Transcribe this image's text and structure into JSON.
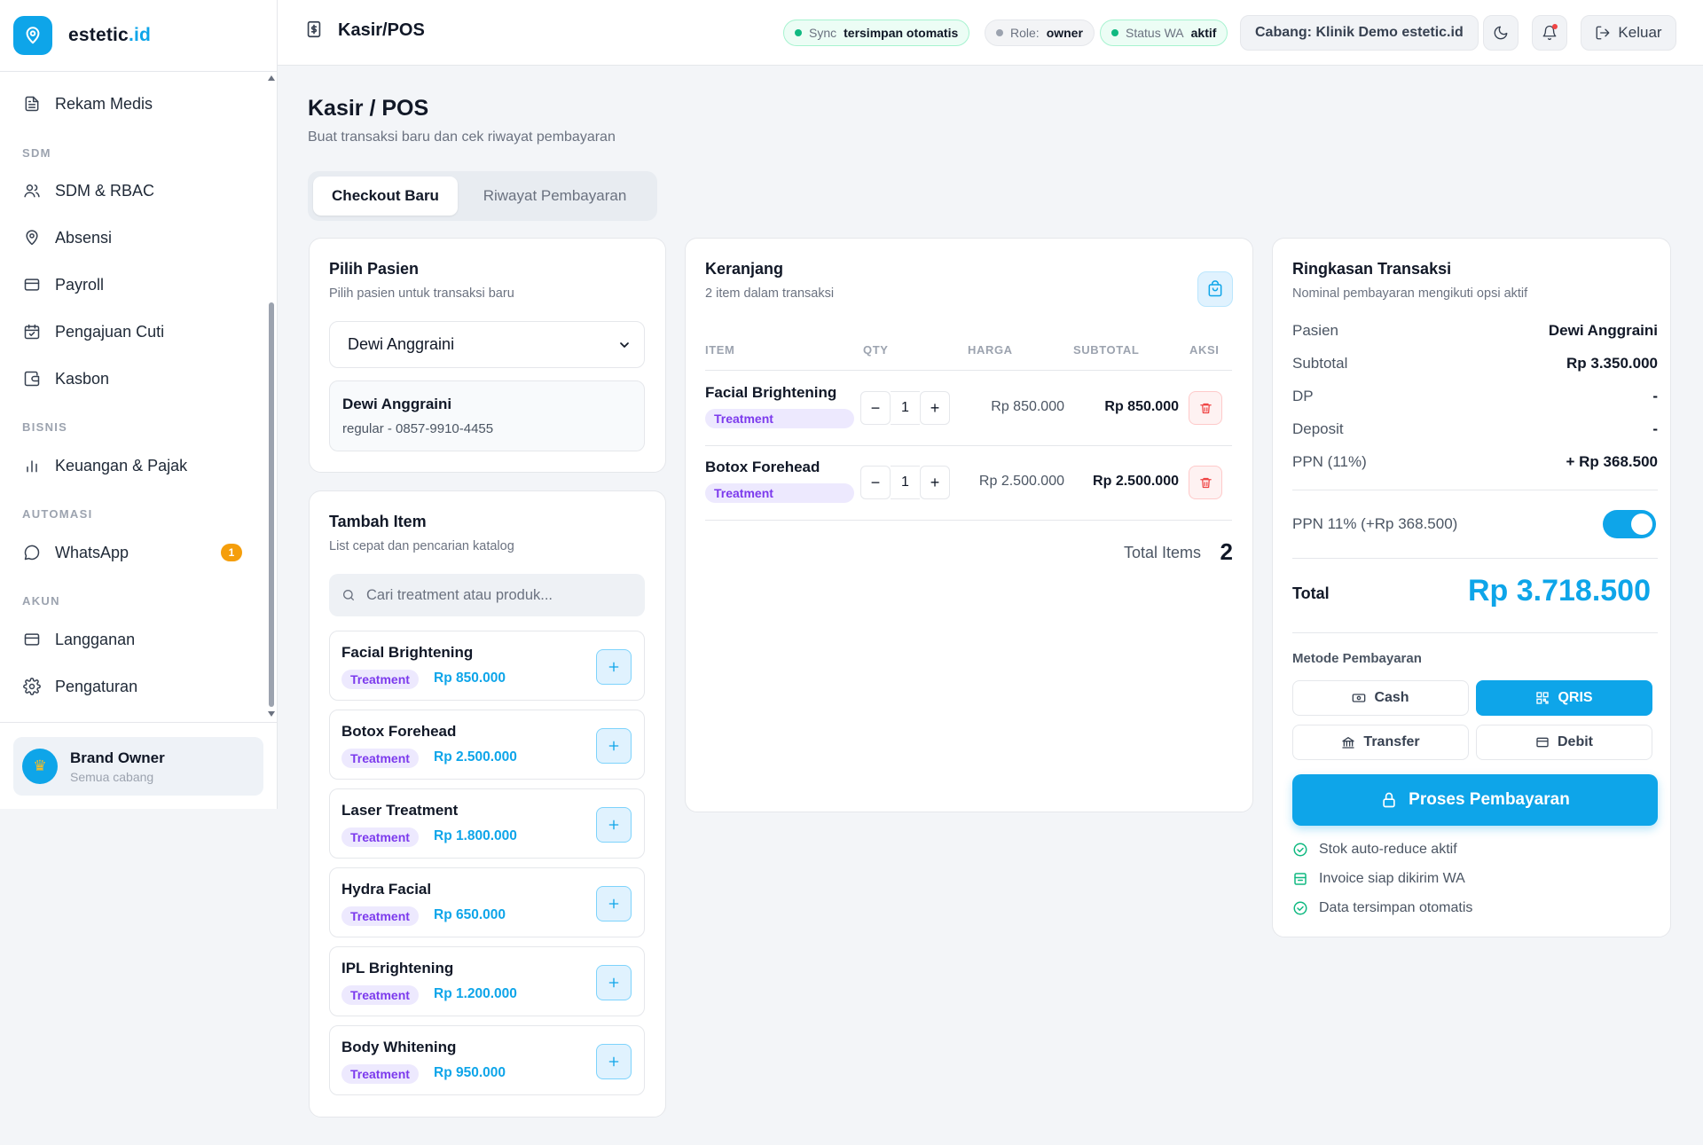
{
  "app": {
    "brand_name": "estetic",
    "brand_tld": ".id",
    "accent": "#0ea5e9"
  },
  "sidebar": {
    "items": [
      {
        "label": "Rekam Medis",
        "icon": "file-text-icon"
      },
      {
        "label": "SDM & RBAC",
        "icon": "users-icon"
      },
      {
        "label": "Absensi",
        "icon": "map-pin-icon"
      },
      {
        "label": "Payroll",
        "icon": "credit-card-icon"
      },
      {
        "label": "Pengajuan Cuti",
        "icon": "calendar-icon"
      },
      {
        "label": "Kasbon",
        "icon": "wallet-icon"
      },
      {
        "label": "Keuangan & Pajak",
        "icon": "bar-chart-icon"
      },
      {
        "label": "WhatsApp",
        "icon": "chat-bubble-icon",
        "badge": "1"
      },
      {
        "label": "Langganan",
        "icon": "credit-card-icon"
      },
      {
        "label": "Pengaturan",
        "icon": "gear-icon"
      }
    ],
    "sections": [
      "SDM",
      "BISNIS",
      "AUTOMASI",
      "AKUN"
    ],
    "user": {
      "name": "Brand Owner",
      "sub": "Semua cabang",
      "avatar": "crown-icon"
    }
  },
  "topbar": {
    "title": "Kasir/POS",
    "sync": {
      "key": "Sync",
      "value": "tersimpan otomatis"
    },
    "role": {
      "key": "Role:",
      "value": "owner"
    },
    "wa": {
      "key": "Status WA",
      "value": "aktif"
    },
    "branch": "Cabang: Klinik Demo estetic.id",
    "logout": "Keluar"
  },
  "page": {
    "title": "Kasir / POS",
    "subtitle": "Buat transaksi baru dan cek riwayat pembayaran",
    "tabs": [
      {
        "label": "Checkout Baru",
        "active": true
      },
      {
        "label": "Riwayat Pembayaran",
        "active": false
      }
    ]
  },
  "patient": {
    "title": "Pilih Pasien",
    "subtitle": "Pilih pasien untuk transaksi baru",
    "selected": "Dewi Anggraini",
    "name": "Dewi Anggraini",
    "detail": "regular - 0857-9910-4455"
  },
  "catalog": {
    "title": "Tambah Item",
    "subtitle": "List cepat dan pencarian katalog",
    "search_placeholder": "Cari treatment atau produk...",
    "items": [
      {
        "name": "Facial Brightening",
        "tag": "Treatment",
        "price": "Rp 850.000"
      },
      {
        "name": "Botox Forehead",
        "tag": "Treatment",
        "price": "Rp 2.500.000"
      },
      {
        "name": "Laser Treatment",
        "tag": "Treatment",
        "price": "Rp 1.800.000"
      },
      {
        "name": "Hydra Facial",
        "tag": "Treatment",
        "price": "Rp 650.000"
      },
      {
        "name": "IPL Brightening",
        "tag": "Treatment",
        "price": "Rp 1.200.000"
      },
      {
        "name": "Body Whitening",
        "tag": "Treatment",
        "price": "Rp 950.000"
      }
    ]
  },
  "cart": {
    "title": "Keranjang",
    "subtitle": "2 item dalam transaksi",
    "columns": [
      "ITEM",
      "QTY",
      "HARGA",
      "SUBTOTAL",
      "AKSI"
    ],
    "items": [
      {
        "name": "Facial Brightening",
        "tag": "Treatment",
        "qty": "1",
        "price": "Rp 850.000",
        "subtotal": "Rp 850.000"
      },
      {
        "name": "Botox Forehead",
        "tag": "Treatment",
        "qty": "1",
        "price": "Rp 2.500.000",
        "subtotal": "Rp 2.500.000"
      }
    ],
    "total_items_label": "Total Items",
    "total_items_value": "2"
  },
  "summary": {
    "title": "Ringkasan Transaksi",
    "subtitle": "Nominal pembayaran mengikuti opsi aktif",
    "rows": [
      {
        "k": "Pasien",
        "v": "Dewi Anggraini"
      },
      {
        "k": "Subtotal",
        "v": "Rp 3.350.000"
      },
      {
        "k": "DP",
        "v": "-"
      },
      {
        "k": "Deposit",
        "v": "-"
      },
      {
        "k": "PPN (11%)",
        "v": "+ Rp 368.500"
      }
    ],
    "ppn_toggle_label": "PPN 11% (+Rp 368.500)",
    "ppn_enabled": true,
    "total_label": "Total",
    "total_value": "Rp 3.718.500",
    "method_label": "Metode Pembayaran",
    "methods": [
      {
        "label": "Cash",
        "icon": "cash-icon",
        "active": false
      },
      {
        "label": "QRIS",
        "icon": "qr-code-icon",
        "active": true
      },
      {
        "label": "Transfer",
        "icon": "bank-icon",
        "active": false
      },
      {
        "label": "Debit",
        "icon": "card-icon",
        "active": false
      }
    ],
    "pay_button": "Proses Pembayaran",
    "features": [
      "Stok auto-reduce aktif",
      "Invoice siap dikirim WA",
      "Data tersimpan otomatis"
    ]
  }
}
